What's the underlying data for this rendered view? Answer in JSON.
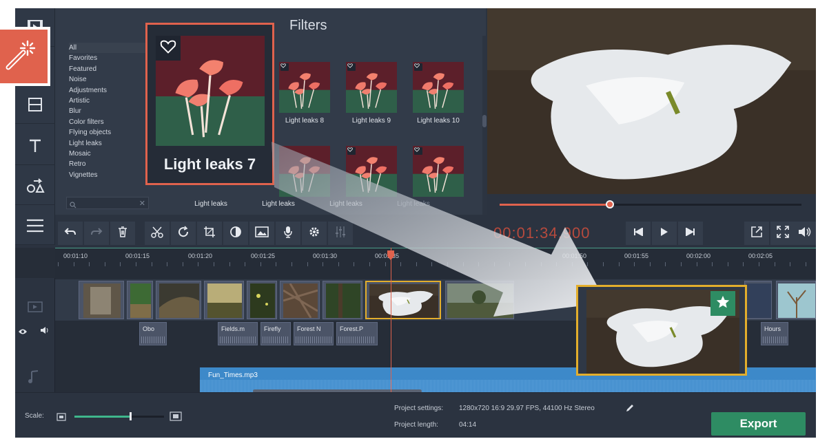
{
  "filters": {
    "title": "Filters",
    "categories": [
      "All",
      "Favorites",
      "Featured",
      "Noise",
      "Adjustments",
      "Artistic",
      "Blur",
      "Color filters",
      "Flying objects",
      "Light leaks",
      "Mosaic",
      "Retro",
      "Vignettes"
    ],
    "active_category": "All",
    "thumbs": [
      {
        "label": "Light leaks 8"
      },
      {
        "label": "Light leaks 9"
      },
      {
        "label": "Light leaks 10"
      },
      {
        "label": "Light leaks"
      },
      {
        "label": "Light leaks"
      },
      {
        "label": "Light leaks"
      },
      {
        "label": "Light leaks"
      }
    ],
    "callout_label": "Light leaks 7"
  },
  "toolbar": {
    "timecode": "00:01:34.900"
  },
  "timeline": {
    "ruler": [
      "00:01:10",
      "00:01:15",
      "00:01:20",
      "00:01:25",
      "00:01:30",
      "00:01:35",
      "00:01:50",
      "00:01:55",
      "00:02:00",
      "00:02:05"
    ],
    "audio_clips": [
      "Obo",
      "Fields.m",
      "Firefly",
      "Forest N",
      "Forest.P",
      "Hours"
    ],
    "music_clip": "Fun_Times.mp3"
  },
  "bottom": {
    "scale_label": "Scale:",
    "project_settings_label": "Project settings:",
    "project_settings_value": "1280x720 16:9 29.97 FPS, 44100 Hz Stereo",
    "project_length_label": "Project length:",
    "project_length_value": "04:14",
    "export_label": "Export",
    "scale_level": 0.62
  },
  "preview": {
    "seek_progress": 0.365
  },
  "colors": {
    "accent": "#e0624d",
    "export": "#2e8c63",
    "selection": "#e3ae2c",
    "music": "#3d89c9"
  },
  "icons": [
    "film-icon",
    "magic-wand-icon",
    "transitions-icon",
    "titles-icon",
    "stickers-icon",
    "list-icon",
    "undo-icon",
    "redo-icon",
    "trash-icon",
    "cut-icon",
    "rotate-icon",
    "crop-icon",
    "contrast-icon",
    "image-icon",
    "mic-icon",
    "gear-icon",
    "equalizer-icon",
    "prev-icon",
    "play-icon",
    "next-icon",
    "popout-icon",
    "fullscreen-icon",
    "volume-icon",
    "heart-icon",
    "star-icon",
    "eye-icon",
    "speaker-icon",
    "note-icon",
    "pencil-icon"
  ]
}
